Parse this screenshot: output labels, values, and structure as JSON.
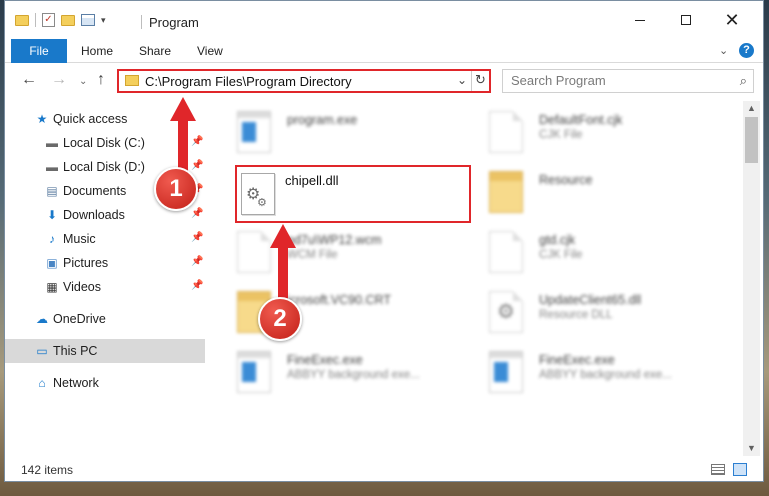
{
  "window": {
    "title": "Program",
    "min_glyph": "—",
    "close_glyph": "✕"
  },
  "ribbon": {
    "tabs": [
      "File",
      "Home",
      "Share",
      "View"
    ],
    "collapse_glyph": "⌄",
    "help_glyph": "?"
  },
  "nav": {
    "back_glyph": "←",
    "forward_glyph": "→",
    "recent_glyph": "⌄",
    "up_glyph": "↑",
    "address": "C:\\Program Files\\Program Directory",
    "addr_chev_glyph": "⌄",
    "refresh_glyph": "↻",
    "search_placeholder": "Search Program",
    "search_icon_glyph": "⌕"
  },
  "sidebar": {
    "pin_glyph": "📌",
    "items": [
      {
        "label": "Quick access",
        "icon": "star-icon",
        "glyph": "★",
        "color": "#1979ca",
        "pinned": false,
        "active": false
      },
      {
        "label": "Local Disk (C:)",
        "icon": "drive-icon",
        "glyph": "▬",
        "color": "#6a6a6a",
        "pinned": true,
        "active": false
      },
      {
        "label": "Local Disk (D:)",
        "icon": "drive-icon",
        "glyph": "▬",
        "color": "#6a6a6a",
        "pinned": true,
        "active": false
      },
      {
        "label": "Documents",
        "icon": "documents-icon",
        "glyph": "▤",
        "color": "#5f7fa3",
        "pinned": true,
        "active": false
      },
      {
        "label": "Downloads",
        "icon": "downloads-icon",
        "glyph": "⬇",
        "color": "#1979ca",
        "pinned": true,
        "active": false
      },
      {
        "label": "Music",
        "icon": "music-icon",
        "glyph": "♪",
        "color": "#1979ca",
        "pinned": true,
        "active": false
      },
      {
        "label": "Pictures",
        "icon": "pictures-icon",
        "glyph": "▣",
        "color": "#4a86c5",
        "pinned": true,
        "active": false
      },
      {
        "label": "Videos",
        "icon": "videos-icon",
        "glyph": "▦",
        "color": "#3a3a3a",
        "pinned": true,
        "active": false
      },
      {
        "label": "OneDrive",
        "icon": "cloud-icon",
        "glyph": "☁",
        "color": "#1979ca",
        "pinned": false,
        "active": false
      },
      {
        "label": "This PC",
        "icon": "computer-icon",
        "glyph": "▭",
        "color": "#1979ca",
        "pinned": false,
        "active": true
      },
      {
        "label": "Network",
        "icon": "network-icon",
        "glyph": "⌂",
        "color": "#1979ca",
        "pinned": false,
        "active": false
      }
    ]
  },
  "files": {
    "gear_glyph": "⚙",
    "items": [
      {
        "name": "program.exe",
        "type": "",
        "kind": "exe"
      },
      {
        "name": "DefaultFont.cjk",
        "type": "CJK File",
        "kind": "doc"
      },
      {
        "name": "Resource",
        "type": "",
        "kind": "folder"
      },
      {
        "name": "nd7u\\WP12.wcm",
        "type": "WCM File",
        "kind": "doc"
      },
      {
        "name": "gtd.cjk",
        "type": "CJK File",
        "kind": "doc"
      },
      {
        "name": "icrosoft.VC90.CRT",
        "type": "",
        "kind": "folder"
      },
      {
        "name": "UpdateClient65.dll",
        "type": "Resource DLL",
        "kind": "gear"
      },
      {
        "name": "FineExec.exe",
        "type": "ABBYY background exe...",
        "kind": "exe"
      },
      {
        "name": "FineExec.exe",
        "type": "ABBYY background exe...",
        "kind": "exe"
      }
    ],
    "highlighted": {
      "name": "chipell.dll",
      "kind": "dll"
    }
  },
  "scrollbar": {
    "up_glyph": "▲",
    "down_glyph": "▼"
  },
  "status": {
    "count": "142 items"
  },
  "annotations": {
    "step1": "1",
    "step2": "2",
    "accent": "#e0262a"
  }
}
